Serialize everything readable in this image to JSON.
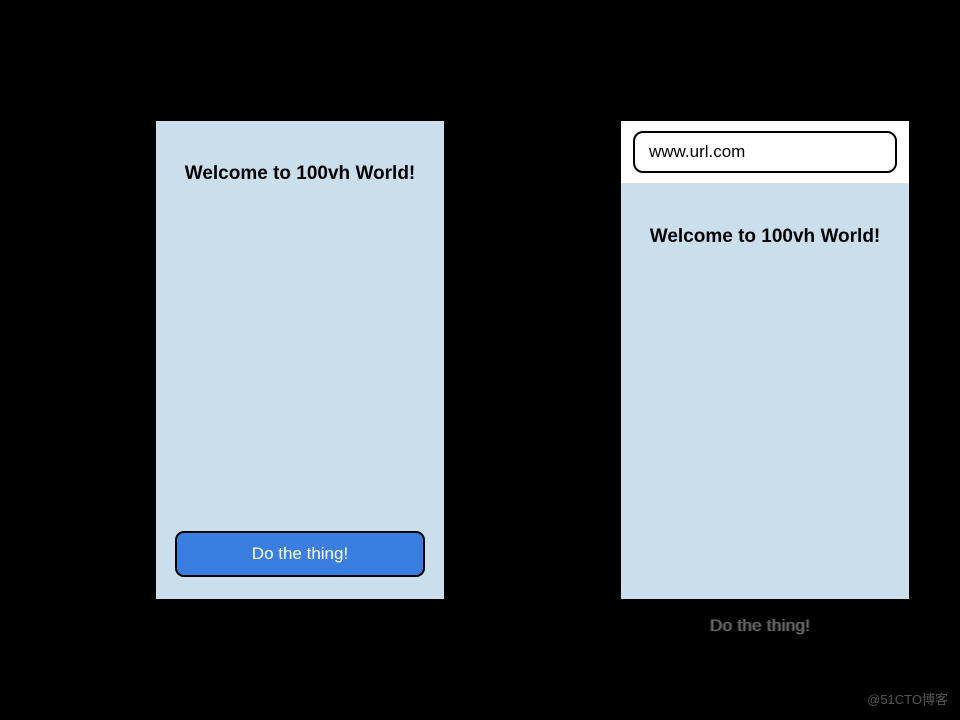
{
  "left_phone": {
    "heading": "Welcome to 100vh World!",
    "cta_label": "Do the thing!"
  },
  "right_phone": {
    "url": "www.url.com",
    "heading": "Welcome to 100vh World!",
    "cta_label": "Do the thing!"
  },
  "watermark": "@51CTO博客",
  "colors": {
    "background": "#000000",
    "content_bg": "#cbdeec",
    "button_bg": "#3a7ee0",
    "button_text": "#ffffff"
  }
}
